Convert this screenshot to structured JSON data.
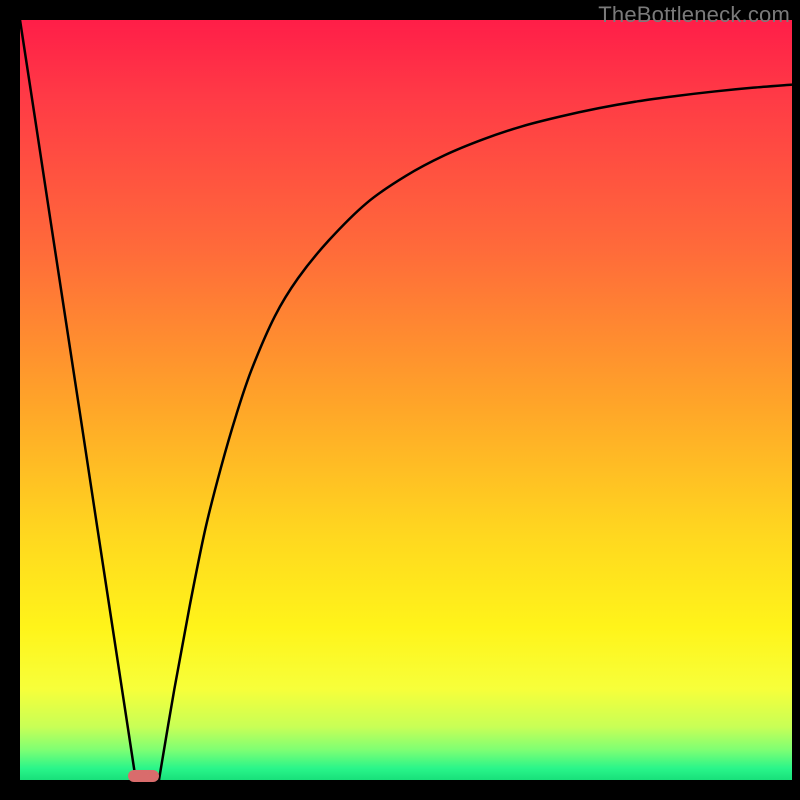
{
  "watermark": "TheBottleneck.com",
  "colors": {
    "background": "#000000",
    "curve": "#000000",
    "bar": "#d96c6c",
    "gradient_top": "#ff1e48",
    "gradient_bottom": "#18e07a"
  },
  "chart_data": {
    "type": "line",
    "title": "",
    "xlabel": "",
    "ylabel": "",
    "xlim": [
      0,
      100
    ],
    "ylim": [
      0,
      100
    ],
    "grid": false,
    "series": [
      {
        "name": "left-branch",
        "x": [
          0,
          2,
          4,
          6,
          8,
          10,
          12,
          14,
          15
        ],
        "values": [
          100,
          86.7,
          73.3,
          60.0,
          46.7,
          33.3,
          20.0,
          6.7,
          0
        ]
      },
      {
        "name": "right-branch",
        "x": [
          18,
          20,
          22,
          24,
          26,
          28,
          30,
          33,
          36,
          40,
          45,
          50,
          55,
          60,
          65,
          70,
          75,
          80,
          85,
          90,
          95,
          100
        ],
        "values": [
          0,
          12,
          23,
          33,
          41,
          48,
          54,
          61,
          66,
          71,
          76,
          79.5,
          82.2,
          84.3,
          86,
          87.3,
          88.4,
          89.3,
          90,
          90.6,
          91.1,
          91.5
        ]
      }
    ],
    "marker": {
      "name": "min-bar",
      "x_start": 14,
      "x_end": 18,
      "y": 0
    }
  }
}
